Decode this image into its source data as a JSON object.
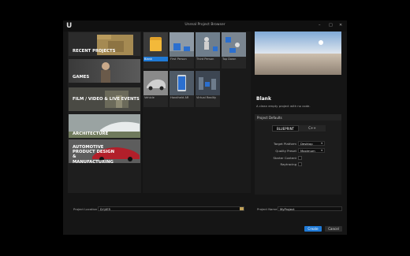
{
  "window": {
    "title": "Unreal Project Browser",
    "minimize": "–",
    "maximize": "□",
    "close": "✕"
  },
  "categories": [
    {
      "label": "RECENT PROJECTS"
    },
    {
      "label": "GAMES"
    },
    {
      "label": "FILM / VIDEO & LIVE EVENTS"
    },
    {
      "label": "ARCHITECTURE"
    },
    {
      "label": "AUTOMOTIVE PRODUCT DESIGN & MANUFACTURING"
    }
  ],
  "templates": [
    {
      "label": "Blank",
      "selected": true
    },
    {
      "label": "First Person"
    },
    {
      "label": "Third Person"
    },
    {
      "label": "Top Down"
    },
    {
      "label": "Vehicle"
    },
    {
      "label": "Handheld AR"
    },
    {
      "label": "Virtual Reality"
    }
  ],
  "preview": {
    "title": "Blank",
    "description": "A clean empty project with no code."
  },
  "defaults": {
    "header": "Project Defaults",
    "toggle": {
      "left": "BLUEPRINT",
      "right": "C++",
      "active": "BLUEPRINT"
    },
    "target_platform_label": "Target Platform",
    "target_platform_value": "Desktop",
    "quality_preset_label": "Quality Preset",
    "quality_preset_value": "Maximum",
    "starter_content_label": "Starter Content",
    "raytracing_label": "Raytracing"
  },
  "bottom": {
    "location_label": "Project Location",
    "location_value": "D:\\UE5",
    "name_label": "Project Name",
    "name_value": "MyProject",
    "create": "Create",
    "cancel": "Cancel"
  },
  "colors": {
    "accent": "#1f7ad6"
  }
}
